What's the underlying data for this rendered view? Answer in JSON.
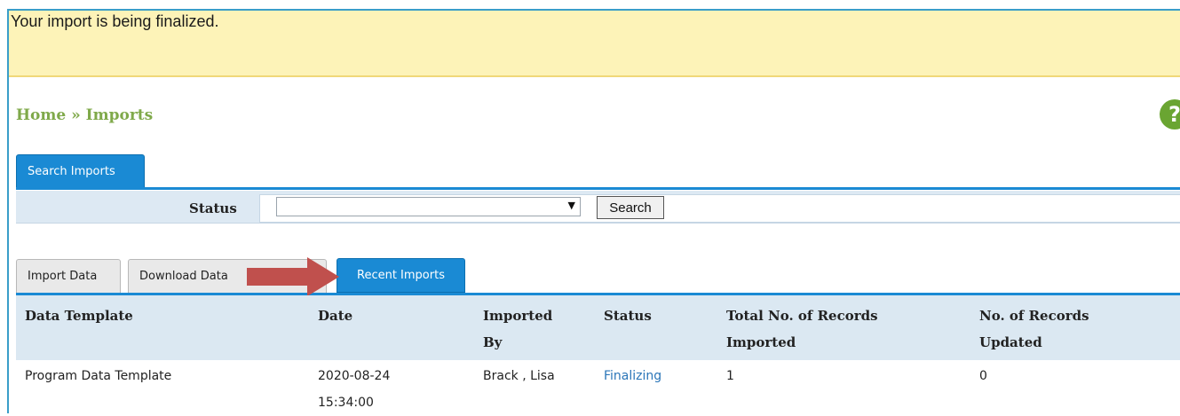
{
  "banner": {
    "message": "Your import is being finalized."
  },
  "breadcrumb": {
    "text": "Home » Imports"
  },
  "help": {
    "glyph": "?"
  },
  "search_tabs": [
    {
      "label": "Search Imports"
    }
  ],
  "search": {
    "status_label": "Status",
    "status_value": "",
    "button_label": "Search"
  },
  "tabs": [
    {
      "label": "Import Data"
    },
    {
      "label": "Download Data"
    },
    {
      "label": "Recent Imports"
    }
  ],
  "table": {
    "headers": [
      "Data Template",
      "Date",
      "Imported By",
      "Status",
      "Total No. of Records Imported",
      "No. of Records Updated"
    ],
    "header_lines": [
      [
        "Data Template"
      ],
      [
        "Date"
      ],
      [
        "Imported",
        "By"
      ],
      [
        "Status"
      ],
      [
        "Total No. of Records",
        "Imported"
      ],
      [
        "No. of Records",
        "Updated"
      ]
    ],
    "rows": [
      {
        "template": "Program Data Template",
        "date": "2020-08-24",
        "time": "15:34:00",
        "imported_by": "Brack , Lisa",
        "status": "Finalizing",
        "total_imported": "1",
        "updated": "0"
      }
    ]
  },
  "colors": {
    "accent": "#1a8ad4",
    "banner": "#fdf3b8",
    "breadcrumb": "#7fa94a",
    "arrow": "#c0504d",
    "link": "#2a75b8"
  }
}
